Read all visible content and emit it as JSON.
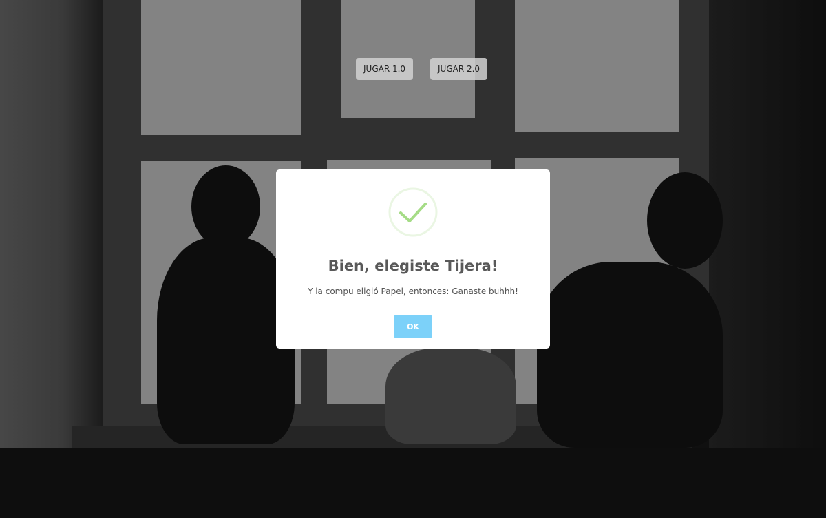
{
  "menu": {
    "play_v1_label": "JUGAR 1.0",
    "play_v2_label": "JUGAR 2.0"
  },
  "modal": {
    "icon": "success-check-icon",
    "title": "Bien, elegiste Tijera!",
    "text": "Y la compu eligió Papel, entonces: Ganaste buhhh!",
    "ok_label": "OK"
  },
  "colors": {
    "ok_button": "#7cd1f9",
    "success_check": "#a5dc86",
    "modal_bg": "#ffffff"
  }
}
